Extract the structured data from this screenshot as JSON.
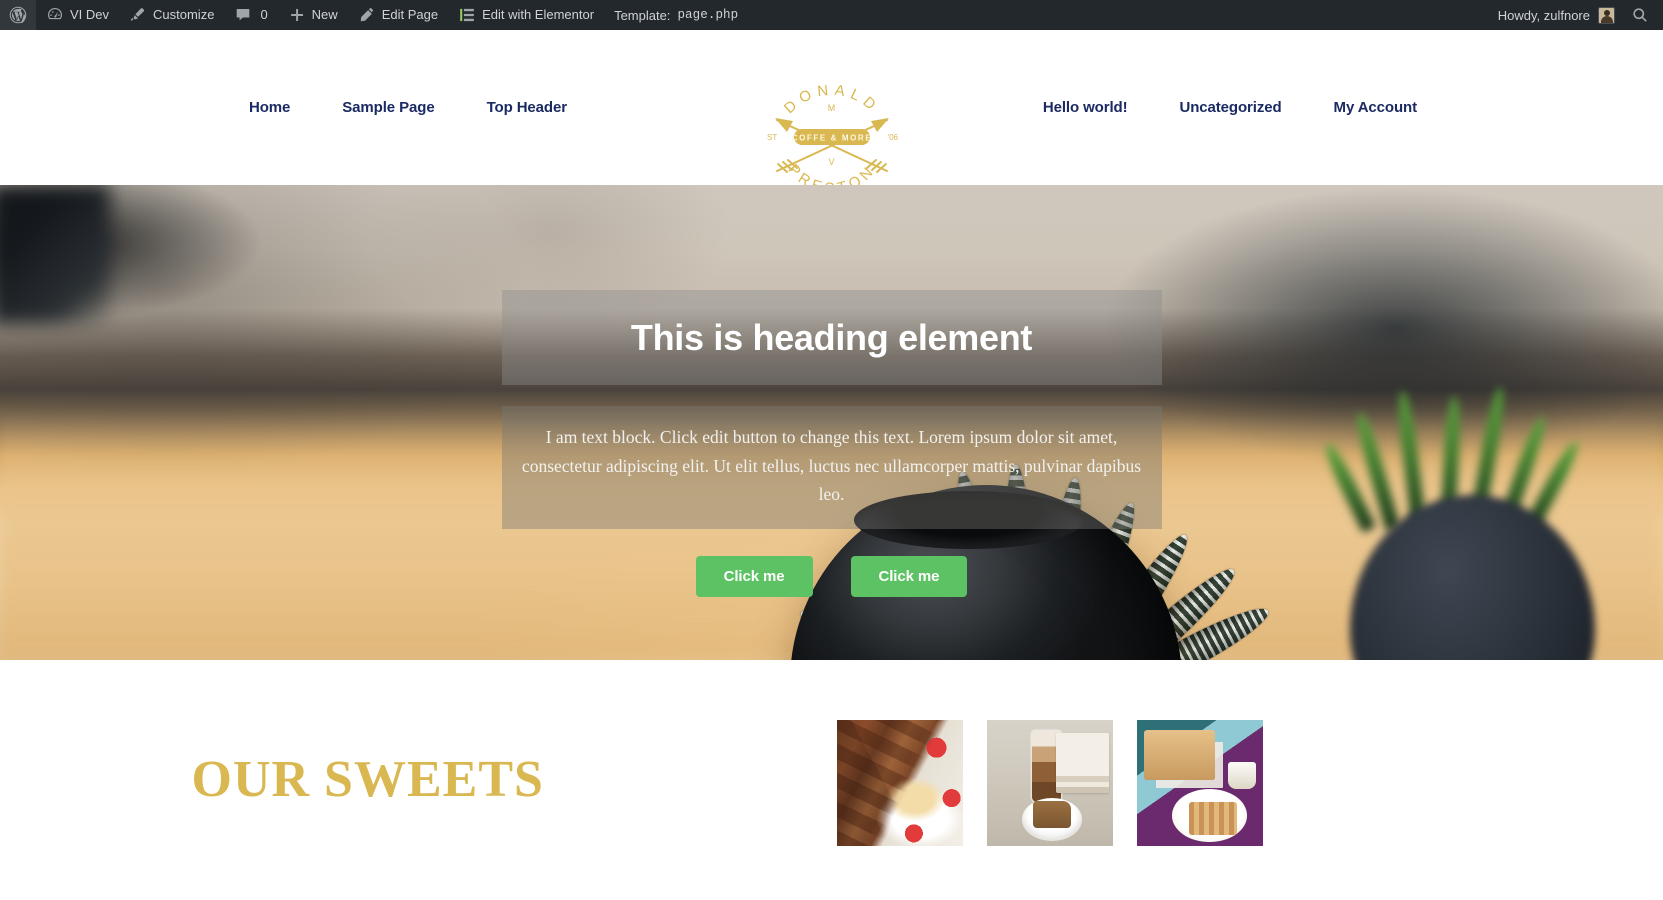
{
  "adminbar": {
    "logo_icon": "wordpress-logo-icon",
    "items": [
      {
        "label": "VI Dev",
        "icon": "dashboard-icon"
      },
      {
        "label": "Customize",
        "icon": "paintbrush-icon"
      },
      {
        "label": "0",
        "icon": "comment-bubble-icon"
      },
      {
        "label": "New",
        "icon": "plus-icon"
      },
      {
        "label": "Edit Page",
        "icon": "pencil-icon"
      },
      {
        "label": "Edit with Elementor",
        "icon": "elementor-list-icon"
      }
    ],
    "template_label": "Template:",
    "template_file": "page.php",
    "howdy": "Howdy, zulfnore",
    "avatar_name": "avatar",
    "search_icon": "search-icon",
    "bg_color": "#23282d",
    "text_color": "#cfd3d6"
  },
  "header": {
    "nav_left": [
      {
        "label": "Home"
      },
      {
        "label": "Sample Page"
      },
      {
        "label": "Top Header"
      }
    ],
    "nav_right": [
      {
        "label": "Hello world!"
      },
      {
        "label": "Uncategorized"
      },
      {
        "label": "My Account"
      }
    ],
    "nav_link_color": "#1b2a63",
    "logo": {
      "name": "donald-preston-coffee-logo",
      "top_arc": "DONALD",
      "bottom_arc": "PRESTON",
      "badge": "COFFE & MORE",
      "letter_top": "M",
      "letter_bottom": "V",
      "left_mark": "ST",
      "right_mark": "'06",
      "color": "#d9b851"
    }
  },
  "hero": {
    "heading": "This is heading element",
    "text": "I am text block. Click edit button to change this text. Lorem ipsum dolor sit amet, consectetur adipiscing elit. Ut elit tellus, luctus nec ullamcorper mattis, pulvinar dapibus leo.",
    "buttons": [
      {
        "label": "Click me"
      },
      {
        "label": "Click me"
      }
    ],
    "button_color": "#5cc263",
    "overlay_color": "rgba(140,140,140,0.42)",
    "background_image_name": "succulent-plant-in-black-pot-on-wooden-table"
  },
  "sweets": {
    "title": "OUR SWEETS",
    "title_color": "#d9b851",
    "gallery": [
      {
        "name": "brownies-with-ice-cream-and-raspberries"
      },
      {
        "name": "latte-with-slice-of-cake-and-books"
      },
      {
        "name": "toasts-with-banana-blueberries-and-waffle"
      }
    ]
  }
}
